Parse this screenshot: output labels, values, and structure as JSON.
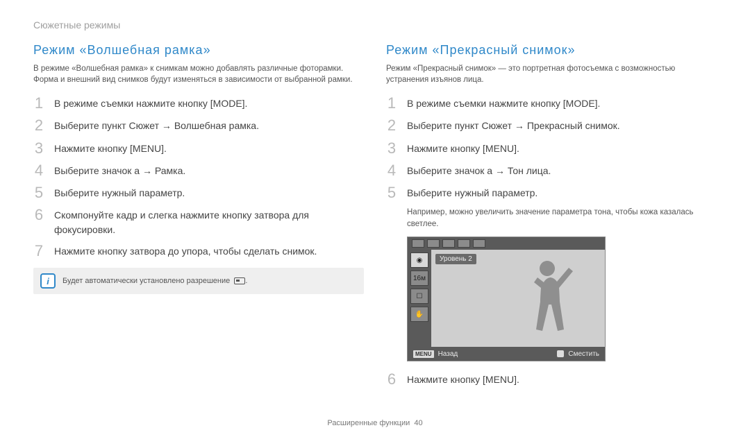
{
  "breadcrumb": "Сюжетные режимы",
  "left": {
    "title": "Режим «Волшебная рамка»",
    "intro": "В режиме «Волшебная рамка» к снимкам можно добавлять различные фоторамки. Форма и внешний вид снимков будут изменяться в зависимости от выбранной рамки.",
    "steps": [
      "В режиме съемки нажмите кнопку [MODE].",
      "Выберите пункт Сюжет → Волшебная рамка.",
      "Нажмите кнопку [MENU].",
      "Выберите значок a → Рамка.",
      "Выберите нужный параметр.",
      "Скомпонуйте кадр и слегка нажмите кнопку затвора для фокусировки.",
      "Нажмите кнопку затвора до упора, чтобы сделать снимок."
    ],
    "note": "Будет автоматически установлено разрешение"
  },
  "right": {
    "title": "Режим «Прекрасный снимок»",
    "intro": "Режим «Прекрасный снимок» — это портретная фотосъемка с возможностью устранения изъянов лица.",
    "steps_before": [
      "В режиме съемки нажмите кнопку [MODE].",
      "Выберите пункт Сюжет → Прекрасный снимок.",
      "Нажмите кнопку [MENU].",
      "Выберите значок a → Тон лица.",
      "Выберите нужный параметр."
    ],
    "sub_after_5": "Например, можно увеличить значение параметра тона, чтобы кожа казалась светлее.",
    "steps_after": [
      "Нажмите кнопку [MENU]."
    ],
    "lcd": {
      "level_label": "Уровень 2",
      "side_labels": [
        "◉",
        "16м",
        "☐",
        "✋"
      ],
      "back": "Назад",
      "menu_tag": "MENU",
      "move": "Сместить"
    }
  },
  "footer": {
    "label": "Расширенные функции",
    "page": "40"
  }
}
